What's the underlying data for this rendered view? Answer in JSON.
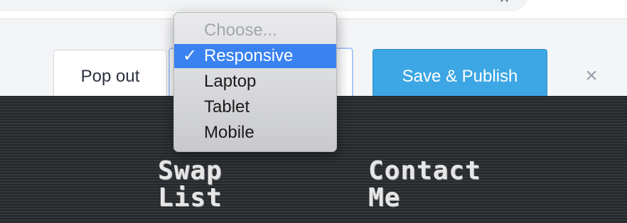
{
  "browser": {
    "close_icon": "x-icon"
  },
  "toolbar": {
    "popout_label": "Pop out",
    "publish_label": "Save & Publish",
    "close_icon": "×"
  },
  "device_select": {
    "options": [
      {
        "label": "Choose...",
        "placeholder": true
      },
      {
        "label": "Responsive",
        "selected": true,
        "check": "✓"
      },
      {
        "label": "Laptop"
      },
      {
        "label": "Tablet"
      },
      {
        "label": "Mobile"
      }
    ]
  },
  "preview": {
    "nav": [
      {
        "lines": [
          "Swap",
          "List"
        ]
      },
      {
        "lines": [
          "Contact",
          "Me"
        ]
      }
    ]
  },
  "colors": {
    "accent": "#3da6e4",
    "selection": "#3a82f0",
    "preview_bg": "#2b2e31"
  }
}
